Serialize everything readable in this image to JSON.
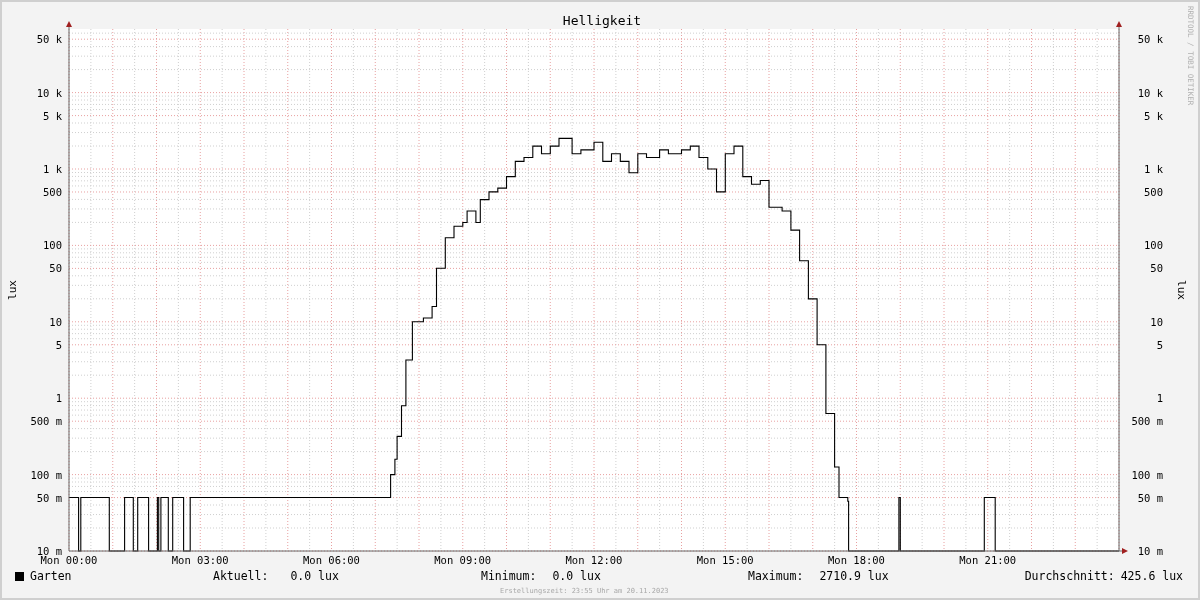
{
  "graph": {
    "title": "Helligkeit",
    "left_axis": {
      "ylabel": "lux",
      "ticks": [
        "50 k",
        "10 k",
        "5 k",
        "1 k",
        "500",
        "100",
        "50",
        "10",
        "5",
        "1",
        "500 m",
        "100 m",
        "50 m",
        "10 m"
      ]
    },
    "right_axis": {
      "ylabel": "lux",
      "ticks": [
        "50 k",
        "10 k",
        "5 k",
        "1 k",
        "500",
        "100",
        "50",
        "10",
        "5",
        "1",
        "500 m",
        "100 m",
        "50 m",
        "10 m"
      ]
    },
    "x_axis": {
      "ticks": [
        "Mon 00:00",
        "Mon 03:00",
        "Mon 06:00",
        "Mon 09:00",
        "Mon 12:00",
        "Mon 15:00",
        "Mon 18:00",
        "Mon 21:00"
      ]
    },
    "series": [
      {
        "name": "Garten",
        "color": "#000000"
      }
    ],
    "stats": [
      {
        "label": "Aktuell:",
        "value": "0.0 lux"
      },
      {
        "label": "Minimum:",
        "value": "0.0 lux"
      },
      {
        "label": "Maximum:",
        "value": "2710.9 lux"
      },
      {
        "label": "Durchschnitt:",
        "value": "425.6 lux"
      }
    ],
    "footer": "Erstellungszeit: 23:55 Uhr am 20.11.2023",
    "credit": "RRDTOOL / TOBI OETIKER"
  }
}
